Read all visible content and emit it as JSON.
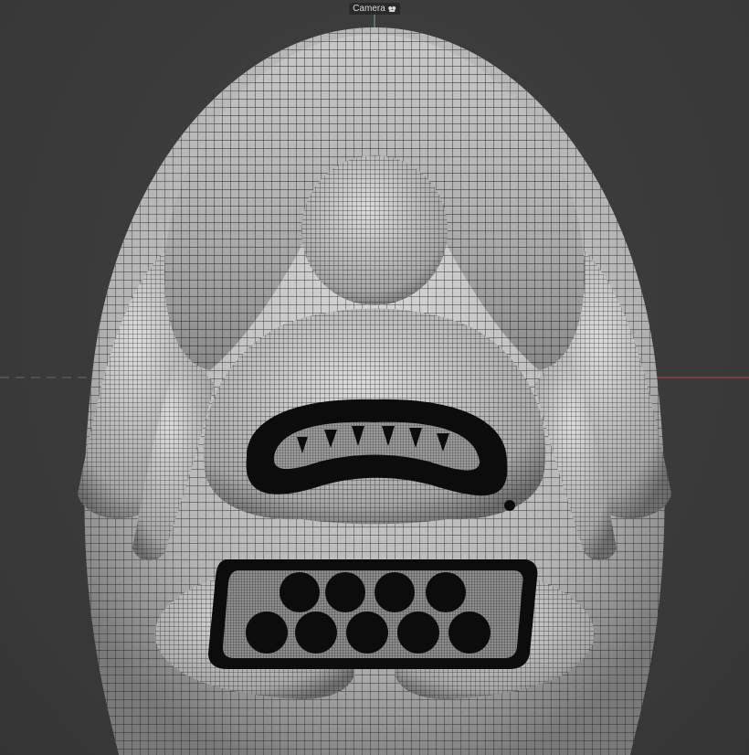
{
  "viewport": {
    "camera_label": "Camera",
    "camera_icon": "camera-icon",
    "colors": {
      "background": "#3b3b3b",
      "mesh_fill": "#b8b8b8",
      "mesh_light": "#d6d6d6",
      "mesh_shadow": "#7a7a7a",
      "wire": "#1e1e1e",
      "dark_part": "#0c0c0c",
      "axis_x": "#c0453f",
      "axis_grid": "#6b6b6b"
    }
  }
}
